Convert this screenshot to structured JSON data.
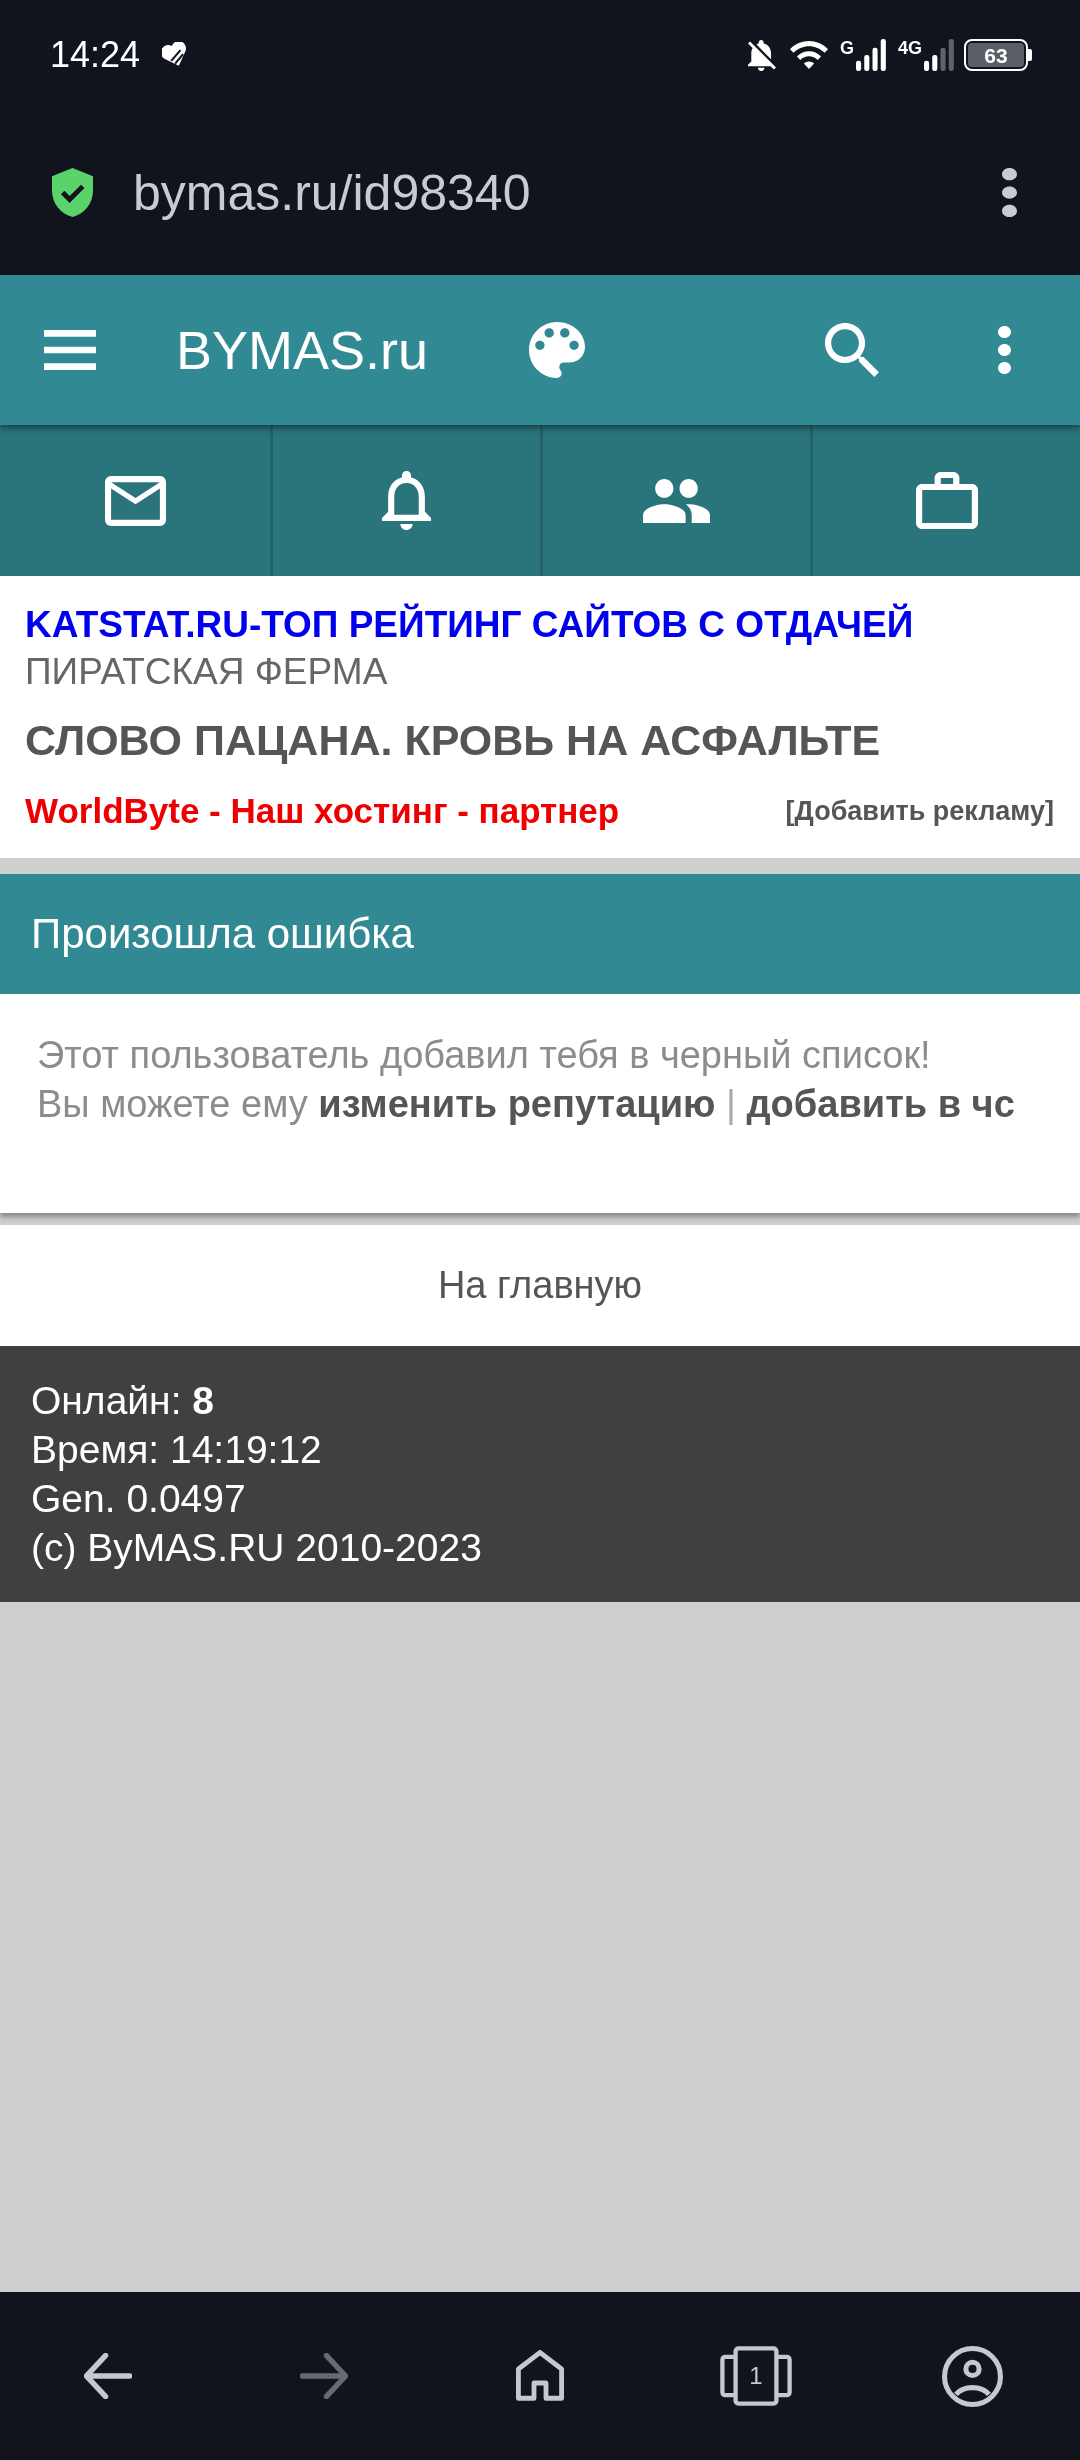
{
  "status_bar": {
    "time": "14:24",
    "networks": [
      {
        "label": "G"
      },
      {
        "label": "4G"
      }
    ],
    "battery": "63"
  },
  "address_bar": {
    "url": "bymas.ru/id98340"
  },
  "header": {
    "title": "BYMAS.ru"
  },
  "ads": {
    "items": [
      {
        "kind": "link",
        "text": "KATSTAT.RU-ТОП РЕЙТИНГ САЙТОВ С ОТДАЧЕЙ"
      },
      {
        "kind": "caption",
        "text": "ПИРАТСКАЯ ФЕРМА"
      },
      {
        "kind": "headline",
        "text": "СЛОВО ПАЦАНА. КРОВЬ НА АСФАЛЬТЕ"
      },
      {
        "kind": "partner",
        "text": "WorldByte - Наш хостинг - партнер"
      }
    ],
    "add_link": "[Добавить рекламу]"
  },
  "error": {
    "title": "Произошла ошибка",
    "message": "Этот пользователь добавил тебя в черный список!",
    "prompt": "Вы можете ему",
    "links": [
      "изменить репутацию",
      "добавить в чс"
    ],
    "separator": "|"
  },
  "home_link": "На главную",
  "footer": {
    "lines": [
      "Онлайн: **8**",
      "Время: 14:19:12",
      "Gen. 0.0497",
      "(c) ByMAS.RU 2010-2023"
    ]
  },
  "browser_nav": {
    "back_disabled": false,
    "forward_disabled": true,
    "tab_count": "1"
  }
}
